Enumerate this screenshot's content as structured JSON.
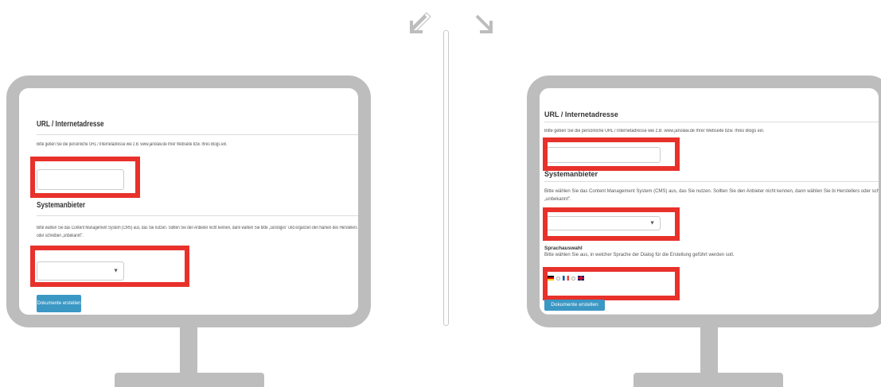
{
  "left": {
    "url_section": {
      "title": "URL / Internetadresse",
      "description": "Bitte geben Sie die persönliche URL / Internetadresse wie z.B. www.janolaw.de Ihrer Webseite bzw. Ihres Blogs ein.",
      "url_value": ""
    },
    "cms_section": {
      "title": "Systemanbieter",
      "description": "Bitte wählen Sie das Content Management System (CMS) aus, das Sie nutzen. Sollten Sie den Anbieter nicht kennen, dann wählen Sie bitte „sonstiges\" und ergänzen den Namen des Herstellers oder schreiben „unbekannt\".",
      "selected": ""
    },
    "create_button": "Dokumente erstellen"
  },
  "right": {
    "url_section": {
      "title": "URL / Internetadresse",
      "description": "Bitte geben Sie die persönliche URL / Internetadresse wie z.B. www.janolaw.de Ihrer Webseite bzw. Ihres Blogs ein.",
      "url_value": ""
    },
    "cms_section": {
      "title": "Systemanbieter",
      "description": "Bitte wählen Sie das Content Management System (CMS) aus, das Sie nutzen. Sollten Sie den Anbieter nicht kennen, dann wählen Sie bi Herstellers oder schreiben „unbekannt\".",
      "selected": ""
    },
    "language_section": {
      "title": "Sprachauswahl",
      "description": "Bitte wählen Sie aus, in welcher Sprache der Dialog für die Erstellung geführt werden soll.",
      "languages": [
        "de",
        "fr",
        "en"
      ]
    },
    "create_button": "Dokumente erstellen"
  },
  "colors": {
    "highlight": "#e8312b",
    "button": "#3b97c4",
    "monitor": "#bdbdbd"
  },
  "icons": {
    "top_left": "arrow-shrink-icon",
    "top_right": "arrow-expand-icon"
  }
}
